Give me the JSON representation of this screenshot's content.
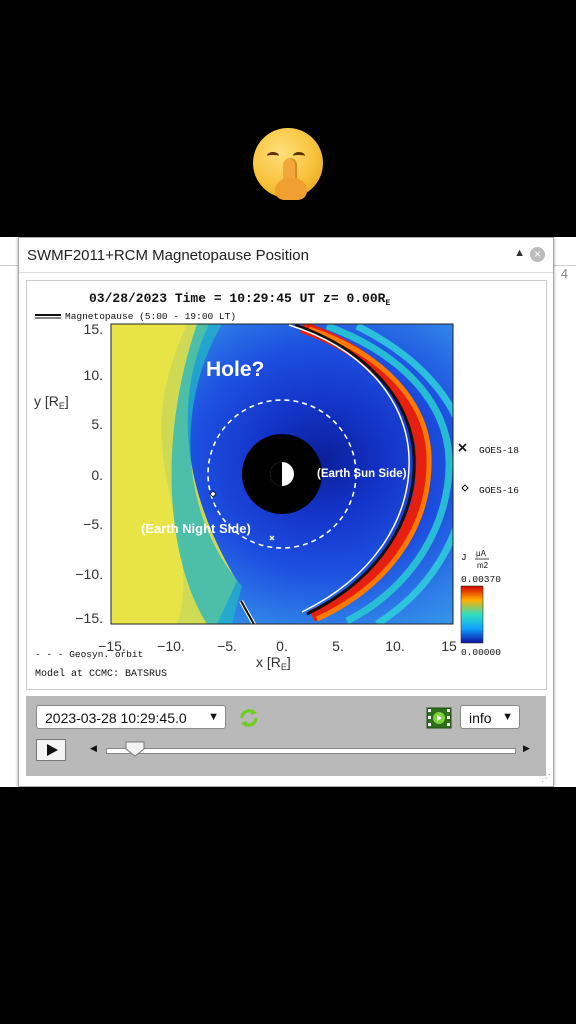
{
  "window": {
    "title": "SWMF2011+RCM Magnetopause Position",
    "collapse_icon": "triangle-up-icon",
    "close_icon": "close-icon"
  },
  "background": {
    "partial_tab_text": "4"
  },
  "plot": {
    "header": "03/28/2023 Time = 10:29:45 UT z= 0.00R",
    "header_sub": "E",
    "legend_magnetopause": "Magnetopause (5:00 - 19:00 LT)",
    "legend_geosyn": "- - - Geosyn. orbit",
    "model_text": "Model at CCMC: BATSRUS",
    "y_label": "y [R",
    "y_label_sub": "E",
    "y_label_end": "]",
    "x_label": "x [R",
    "x_label_sub": "E",
    "x_label_end": "]",
    "y_ticks": [
      "15.",
      "10.",
      "5.",
      "0.",
      "−5.",
      "−10.",
      "−15."
    ],
    "x_ticks": [
      "−15.",
      "−10.",
      "−5.",
      "0.",
      "5.",
      "10.",
      "15"
    ],
    "goes18": "GOES-18",
    "goes16": "GOES-16",
    "colorbar_label": "J",
    "colorbar_units_top": "μA",
    "colorbar_units_bottom": "m2",
    "colorbar_max": "0.00370",
    "colorbar_min": "0.00000",
    "annotation_hole": "Hole?",
    "annotation_sun": "(Earth Sun Side)",
    "annotation_night": "(Earth Night Side)"
  },
  "controls": {
    "datetime": "2023-03-28 10:29:45.0",
    "info_label": "info",
    "refresh_icon": "refresh-icon",
    "film_icon": "film-play-icon",
    "play_icon": "play-icon",
    "slider_position": 0.05
  },
  "colors": {
    "accent_green": "#6ccf1f",
    "control_bar": "#b9b9b9",
    "plasma_blue": "#1a3fd6",
    "plasma_yellow": "#e8e24a"
  }
}
